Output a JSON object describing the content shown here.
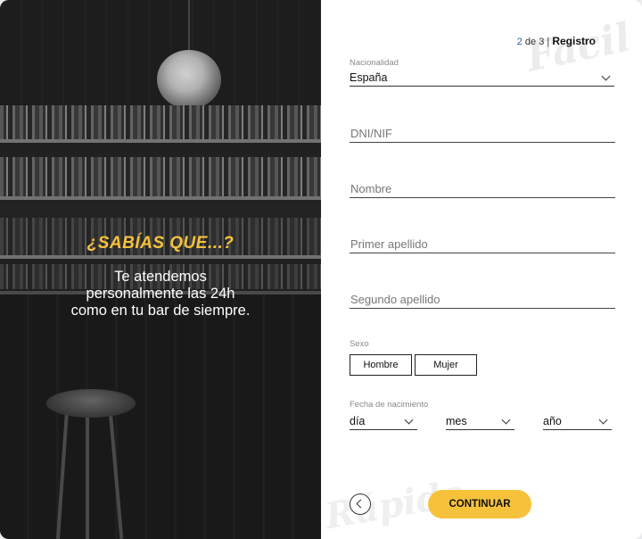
{
  "left_panel": {
    "fact_title": "¿SABÍAS QUE...?",
    "fact_lines": [
      "Te atendemos",
      "personalmente las 24h",
      "como en tu bar de siempre."
    ]
  },
  "watermarks": {
    "top": "Facil",
    "bottom": "Rápido"
  },
  "step": {
    "current": "2",
    "of_text": "de",
    "total": "3",
    "separator": "|",
    "title": "Registro"
  },
  "form": {
    "nationality": {
      "label": "Nacionalidad",
      "value": "España"
    },
    "dni": {
      "placeholder": "DNI/NIF",
      "value": ""
    },
    "nombre": {
      "placeholder": "Nombre",
      "value": ""
    },
    "primer_apellido": {
      "placeholder": "Primer apellido",
      "value": ""
    },
    "segundo_apellido": {
      "placeholder": "Segundo apellido",
      "value": ""
    },
    "sexo": {
      "label": "Sexo",
      "options": [
        "Hombre",
        "Mujer"
      ]
    },
    "fecha": {
      "label": "Fecha de nacimiento",
      "day": "día",
      "month": "mes",
      "year": "año"
    }
  },
  "actions": {
    "continue_label": "CONTINUAR"
  },
  "colors": {
    "accent": "#f6c23c",
    "step_number": "#2a5aa0"
  }
}
